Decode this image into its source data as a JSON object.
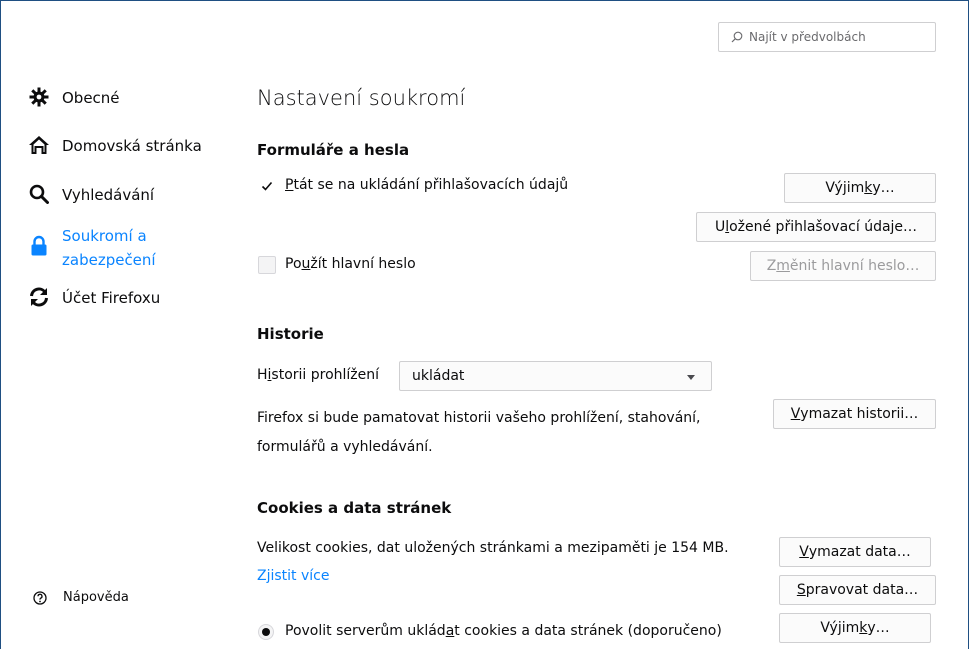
{
  "search": {
    "placeholder": "Najít v předvolbách",
    "icon": "search-icon"
  },
  "sidebar": {
    "items": [
      {
        "label": "Obecné",
        "icon": "gear-icon"
      },
      {
        "label": "Domovská stránka",
        "icon": "home-icon"
      },
      {
        "label": "Vyhledávání",
        "icon": "search-icon"
      },
      {
        "label_line1": "Soukromí a",
        "label_line2": "zabezpečení",
        "icon": "lock-icon",
        "active": true
      },
      {
        "label": "Účet Firefoxu",
        "icon": "sync-icon"
      }
    ],
    "help": {
      "label": "Nápověda",
      "icon": "help-icon"
    }
  },
  "main": {
    "title": "Nastavení soukromí",
    "forms": {
      "heading": "Formuláře a hesla",
      "ask_save": {
        "checked": true,
        "pre": "",
        "accesskey": "P",
        "post": "tát se na ukládání přihlašovacích údajů"
      },
      "exceptions_btn": {
        "pre": "Výjim",
        "accesskey": "k",
        "post": "y…"
      },
      "saved_logins_btn": {
        "pre": "U",
        "accesskey": "l",
        "post": "ožené přihlašovací údaje…"
      },
      "master_password": {
        "checked": false,
        "pre": "Po",
        "accesskey": "u",
        "post": "žít hlavní heslo"
      },
      "change_master_btn": {
        "pre": "Z",
        "accesskey": "m",
        "post": "ěnit hlavní heslo…"
      }
    },
    "history": {
      "heading": "Historie",
      "label_pre": "H",
      "label_accesskey": "i",
      "label_post": "storii prohlížení",
      "select_value": "ukládat",
      "description_line1": "Firefox si bude pamatovat historii vašeho prohlížení, stahování,",
      "description_line2": "formulářů a vyhledávání.",
      "clear_btn": {
        "pre": "",
        "accesskey": "V",
        "post": "ymazat historii…"
      }
    },
    "cookies": {
      "heading": "Cookies a data stránek",
      "size_text": "Velikost cookies, dat uložených stránkami a mezipaměti je 154 MB.",
      "learn_more": "Zjistit více",
      "clear_data_btn": {
        "pre": "",
        "accesskey": "V",
        "post": "ymazat data…"
      },
      "manage_data_btn": {
        "pre": "",
        "accesskey": "S",
        "post": "pravovat data…"
      },
      "allow_radio": {
        "selected": true,
        "pre": "Povolit serverům uklád",
        "accesskey": "a",
        "post": "t cookies a data stránek (doporučeno)"
      },
      "exceptions_btn": {
        "pre": "Výjim",
        "accesskey": "k",
        "post": "y…"
      }
    }
  },
  "colors": {
    "accent": "#0a84ff",
    "text": "#0c0c0d",
    "border": "#cfcfd1"
  }
}
